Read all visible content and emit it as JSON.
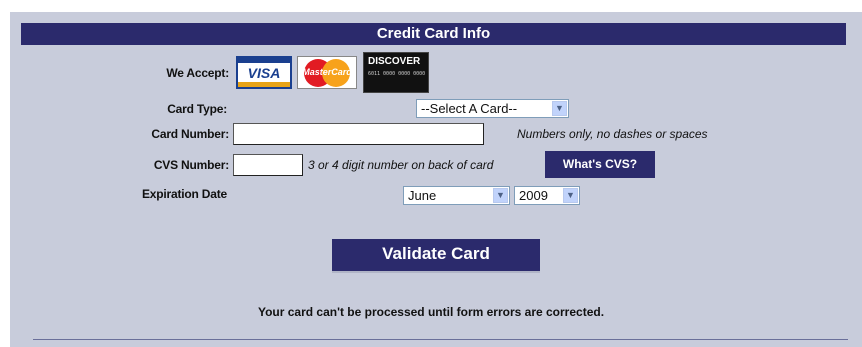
{
  "header": {
    "title": "Credit Card Info"
  },
  "accept": {
    "label": "We Accept:",
    "cards": [
      "VISA",
      "MasterCard",
      "DISCOVER"
    ]
  },
  "card_type": {
    "label": "Card Type:",
    "selected": "--Select A Card--"
  },
  "card_number": {
    "label": "Card Number:",
    "value": "",
    "hint": "Numbers only, no dashes or spaces"
  },
  "cvs_number": {
    "label": "CVS Number:",
    "value": "",
    "hint": "3 or 4 digit number on back of card",
    "button": "What's CVS?"
  },
  "expiration": {
    "label": "Expiration Date",
    "month": "June",
    "year": "2009"
  },
  "actions": {
    "validate_label": "Validate Card"
  },
  "status": {
    "message": "Your card can't be processed until form errors are corrected."
  },
  "colors": {
    "accent": "#2b2a6c",
    "panel": "#c8ccdb"
  }
}
